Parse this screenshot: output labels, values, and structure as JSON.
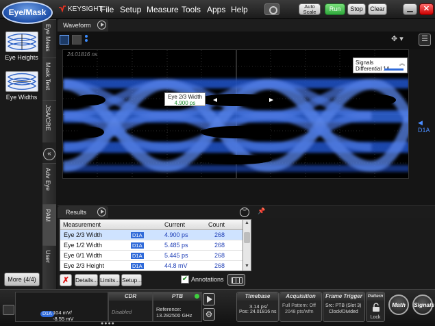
{
  "title_bar": {
    "app_button": "Eye/Mask",
    "logo": "KEYSIGHT",
    "menu": [
      "File",
      "Setup",
      "Measure",
      "Tools",
      "Apps",
      "Help"
    ],
    "buttons": {
      "autoscale": "Auto Scale",
      "run": "Run",
      "stop": "Stop",
      "clear": "Clear"
    }
  },
  "left_panel": {
    "items": [
      {
        "label": "Eye Heights",
        "icon": "eye-heights-icon"
      },
      {
        "label": "Eye Widths",
        "icon": "eye-widths-icon"
      }
    ],
    "more_button": "More (4/4)"
  },
  "vertical_tabs": [
    "Eye Meas",
    "Mask Test",
    "JSA/CRE",
    "Adv Eye",
    "PAM",
    "User"
  ],
  "waveform": {
    "tab": "Waveform",
    "timestamp": "24.01816 ns",
    "signals_panel": {
      "title": "Signals",
      "item": "Differential 1A"
    },
    "measurement_label": {
      "name": "Eye 2/3 Width",
      "value": "4.900 ps"
    },
    "channel_marker": "D1A"
  },
  "results": {
    "tab": "Results",
    "columns": [
      "Measurement",
      "Current",
      "Count"
    ],
    "rows": [
      {
        "measurement": "Eye 2/3 Width",
        "source": "D1A",
        "current": "4.900 ps",
        "count": "268"
      },
      {
        "measurement": "Eye 1/2 Width",
        "source": "D1A",
        "current": "5.485 ps",
        "count": "268"
      },
      {
        "measurement": "Eye 0/1 Width",
        "source": "D1A",
        "current": "5.445 ps",
        "count": "268"
      },
      {
        "measurement": "Eye 2/3 Height",
        "source": "D1A",
        "current": "44.8 mV",
        "count": "268"
      }
    ],
    "buttons": {
      "details": "Details...",
      "limits": "Limits...",
      "setup": "Setup..."
    },
    "annotations_label": "Annotations",
    "annotations_checked": true
  },
  "status_bar": {
    "channel": {
      "badge": "D1A",
      "scale": "104 mV/",
      "offset": "-8.55 mV"
    },
    "cdr": {
      "title": "CDR",
      "value": "Disabled"
    },
    "ptb": {
      "title": "PTB",
      "line1": "Reference:",
      "line2": "13.282500 GHz"
    },
    "timebase": {
      "title": "Timebase",
      "line1": "3.14 ps/",
      "line2": "Pos: 24.01816 ns"
    },
    "acquisition": {
      "title": "Acquisition",
      "line1": "Full Pattern: Off",
      "line2": "2048 pts/wfm"
    },
    "frame_trigger": {
      "title": "Frame Trigger",
      "line1": "Src: PTB (Slot 3)",
      "line2": "Clock/Divided"
    },
    "pattern": {
      "title": "Pattern",
      "lock": "Lock"
    },
    "math_button": "Math",
    "signals_button": "Signals"
  }
}
